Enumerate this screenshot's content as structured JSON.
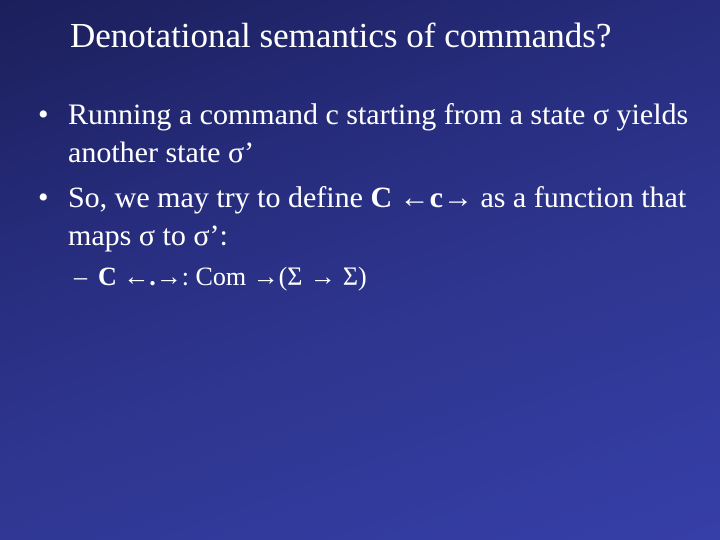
{
  "title": "Denotational semantics of commands?",
  "bullet1_a": "Running a command c starting from a state ",
  "sigma1": "σ",
  "bullet1_b": " yields another state ",
  "sigma2": "σ",
  "prime1": "’",
  "bullet2_a": "So, we may try to define ",
  "C1": "C ",
  "arr_l1": "←",
  "c_small": "c",
  "arr_r1": "→",
  "bullet2_b": " as a function that maps ",
  "sigma3": "σ",
  "bullet2_c": " to ",
  "sigma4": "σ",
  "prime2": "’",
  "colon1": ":",
  "sub_C": "C ",
  "arr_l2": "←",
  "dot": ".",
  "arr_r2": "→",
  "sub_colon": ": Com ",
  "arr_to1": "→",
  "lpar": "(",
  "Sigma1": "Σ",
  "arr_to2": " → ",
  "Sigma2": "Σ",
  "rpar": ")"
}
